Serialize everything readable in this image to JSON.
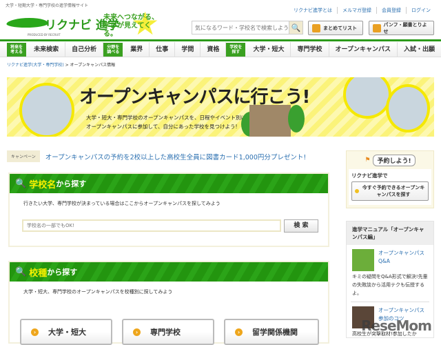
{
  "header": {
    "tagline": "大学・短期大学・専門学校の進学情報サイト",
    "logo": "リクナビ 進学",
    "logo_sub": "PRODUCED BY RECRUIT",
    "slogan": "未来へつながる、学びが見えてくる。",
    "links": [
      "リクナビ進学とは",
      "メルマガ登録",
      "会員登録",
      "ログイン"
    ],
    "search_placeholder": "気になるワード・学校名で検索しよう",
    "list_button": "まとめてリスト",
    "pamph_button": "パンフ・願書とりよせ"
  },
  "nav": [
    {
      "tag": "将来を考える",
      "items": [
        "未来検索",
        "自己分析"
      ]
    },
    {
      "tag": "分野を調べる",
      "items": [
        "業界",
        "仕事",
        "学問",
        "資格"
      ]
    },
    {
      "tag": "学校を探す",
      "items": [
        "大学・短大",
        "専門学校",
        "オープンキャンパス",
        "入試・出願"
      ]
    }
  ],
  "breadcrumb": {
    "home": "リクナビ進学(大学・専門学校)",
    "current": "オープンキャンパス情報"
  },
  "banner": {
    "title": "オープンキャンパスに行こう!",
    "desc1": "大学・短大・専門学校のオープンキャンパスを、日程やイベント別に詳しく探せるよ。",
    "desc2": "オープンキャンパスに参加して、自分にあった学校を見つけよう!"
  },
  "campaign": {
    "label": "キャンペーン",
    "text": "オープンキャンパスの予約を2校以上した高校生全員に図書カード1,000円分プレゼント!"
  },
  "name_search": {
    "title_hl": "学校名",
    "title_rest": "から探す",
    "desc": "行きたい大学、専門学校が決まっている場合はここからオープンキャンパスを探してみよう",
    "placeholder": "学校名の一部でもOK!",
    "button": "検 索"
  },
  "type_search": {
    "title_hl": "校種",
    "title_rest": "から探す",
    "desc": "大学・短大、専門学校のオープンキャンパスを校種別に探してみよう",
    "buttons": [
      "大学・短大",
      "専門学校",
      "留学関係機関"
    ]
  },
  "sidebar": {
    "reserve_title": "予約しよう!",
    "reserve_lead": "リクナビ進学で",
    "reserve_button": "今すぐ予約できるオープンキャンパスを探す",
    "manual_title": "進学マニュアル「オープンキャンパス編」",
    "articles": [
      {
        "title": "オープンキャンパスQ&A",
        "desc": "キミの疑問をQ&A形式で解決!先輩の失敗談から活用テクも伝授するよ。"
      },
      {
        "title": "オープンキャンパス参加のコツ",
        "desc": "高校生が突撃取材!参加したか"
      }
    ]
  },
  "watermark": "ReseMom"
}
